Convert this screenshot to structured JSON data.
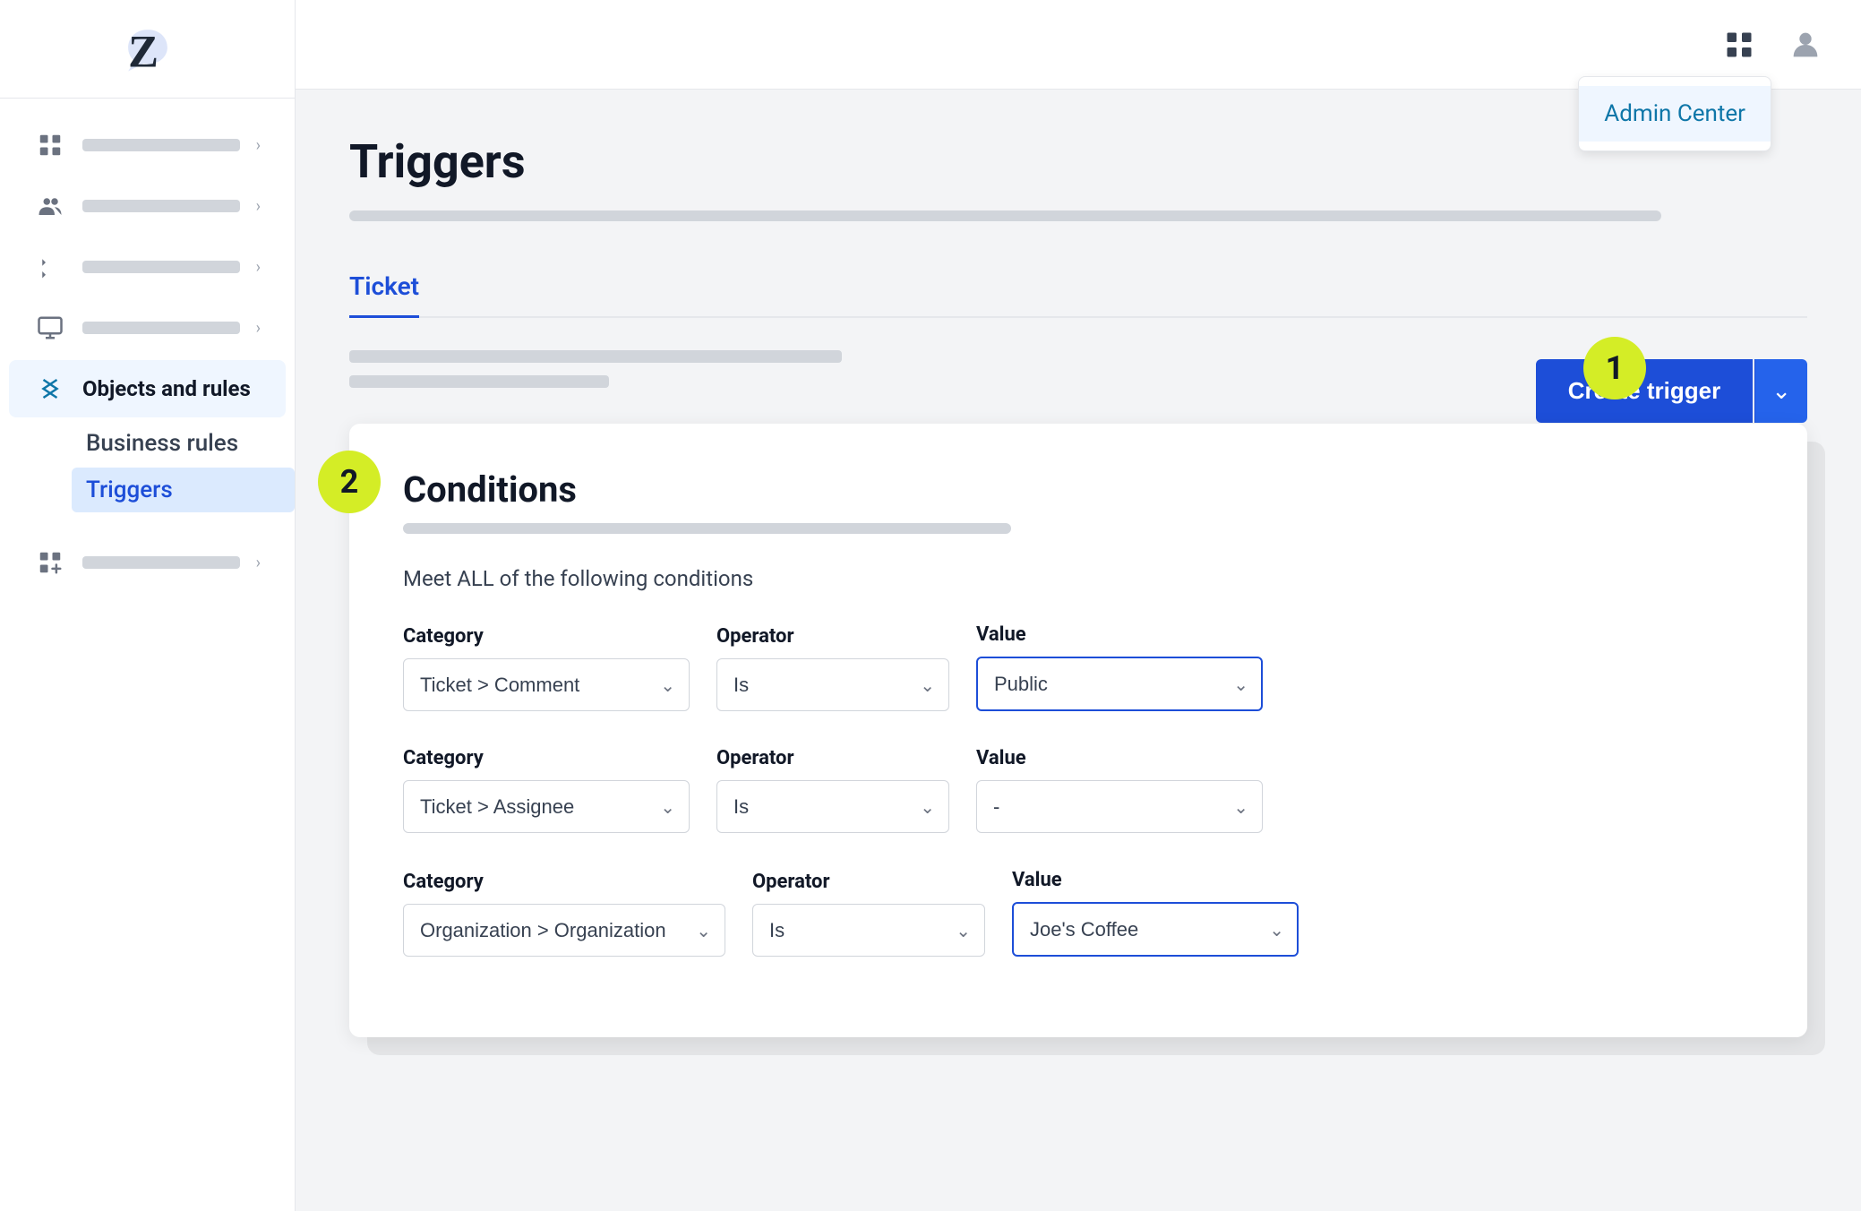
{
  "sidebar": {
    "logo_alt": "Zendesk Logo",
    "nav_items": [
      {
        "id": "workspace",
        "icon": "building-icon",
        "active": false
      },
      {
        "id": "people",
        "icon": "people-icon",
        "active": false
      },
      {
        "id": "channels",
        "icon": "channels-icon",
        "active": false
      },
      {
        "id": "workspaces",
        "icon": "workspaces-icon",
        "active": false
      },
      {
        "id": "objects-rules",
        "icon": "objects-rules-icon",
        "label": "Objects and rules",
        "active": true
      },
      {
        "id": "apps",
        "icon": "apps-icon",
        "active": false
      }
    ],
    "sub_items": [
      {
        "id": "business-rules",
        "label": "Business rules"
      },
      {
        "id": "triggers",
        "label": "Triggers",
        "active": true
      }
    ]
  },
  "topbar": {
    "grid_icon": "grid-icon",
    "user_icon": "user-icon",
    "admin_center_label": "Admin Center"
  },
  "page": {
    "title": "Triggers",
    "tab_label": "Ticket",
    "create_trigger_label": "Create trigger",
    "step1_number": "1",
    "step2_number": "2"
  },
  "conditions": {
    "title": "Conditions",
    "subtitle": "Meet ALL of the following conditions",
    "rows": [
      {
        "category_label": "Category",
        "category_value": "Ticket > Comment",
        "operator_label": "Operator",
        "operator_value": "Is",
        "value_label": "Value",
        "value_value": "Public",
        "value_highlighted": true
      },
      {
        "category_label": "Category",
        "category_value": "Ticket > Assignee",
        "operator_label": "Operator",
        "operator_value": "Is",
        "value_label": "Value",
        "value_value": "-",
        "value_highlighted": false
      },
      {
        "category_label": "Category",
        "category_value": "Organization > Organization",
        "operator_label": "Operator",
        "operator_value": "Is",
        "value_label": "Value",
        "value_value": "Joe's Coffee",
        "value_highlighted": true
      }
    ]
  }
}
